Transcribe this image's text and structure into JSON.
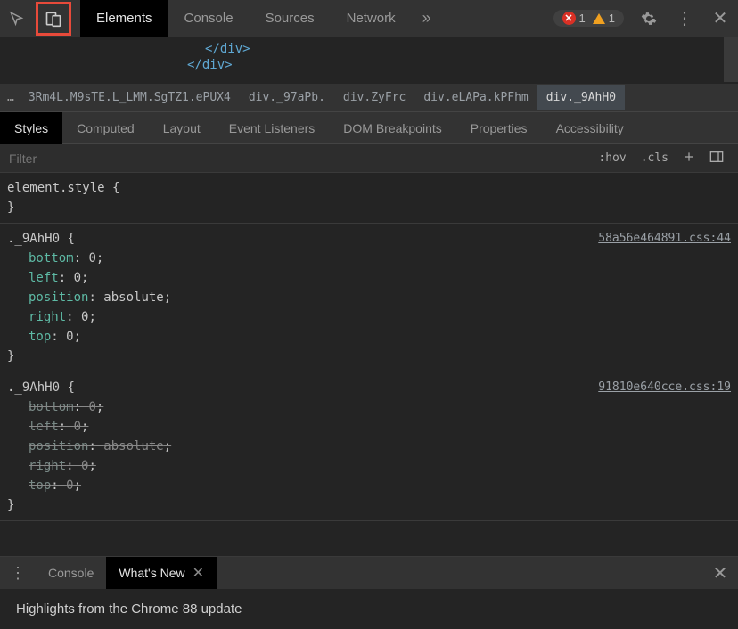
{
  "toolbar": {
    "tabs": [
      "Elements",
      "Console",
      "Sources",
      "Network"
    ],
    "active_tab": 0,
    "errors": "1",
    "warnings": "1"
  },
  "dom_preview": {
    "lines": [
      "</div>",
      "</div>"
    ]
  },
  "breadcrumb": {
    "ellipsis": "…",
    "items": [
      "3Rm4L.M9sTE.L_LMM.SgTZ1.ePUX4",
      "div._97aPb.",
      "div.ZyFrc",
      "div.eLAPa.kPFhm",
      "div._9AhH0"
    ],
    "selected": 4
  },
  "panel_tabs": [
    "Styles",
    "Computed",
    "Layout",
    "Event Listeners",
    "DOM Breakpoints",
    "Properties",
    "Accessibility"
  ],
  "filter": {
    "placeholder": "Filter",
    "hov": ":hov",
    "cls": ".cls"
  },
  "styles": [
    {
      "selector": "element.style",
      "src": "",
      "rules": []
    },
    {
      "selector": "._9AhH0",
      "src": "58a56e464891.css:44",
      "rules": [
        {
          "n": "bottom",
          "v": "0"
        },
        {
          "n": "left",
          "v": "0"
        },
        {
          "n": "position",
          "v": "absolute"
        },
        {
          "n": "right",
          "v": "0"
        },
        {
          "n": "top",
          "v": "0"
        }
      ],
      "strike": false
    },
    {
      "selector": "._9AhH0",
      "src": "91810e640cce.css:19",
      "rules": [
        {
          "n": "bottom",
          "v": "0"
        },
        {
          "n": "left",
          "v": "0"
        },
        {
          "n": "position",
          "v": "absolute"
        },
        {
          "n": "right",
          "v": "0"
        },
        {
          "n": "top",
          "v": "0"
        }
      ],
      "strike": true
    }
  ],
  "drawer": {
    "tabs": [
      "Console",
      "What's New"
    ],
    "active": 1,
    "content": "Highlights from the Chrome 88 update"
  }
}
